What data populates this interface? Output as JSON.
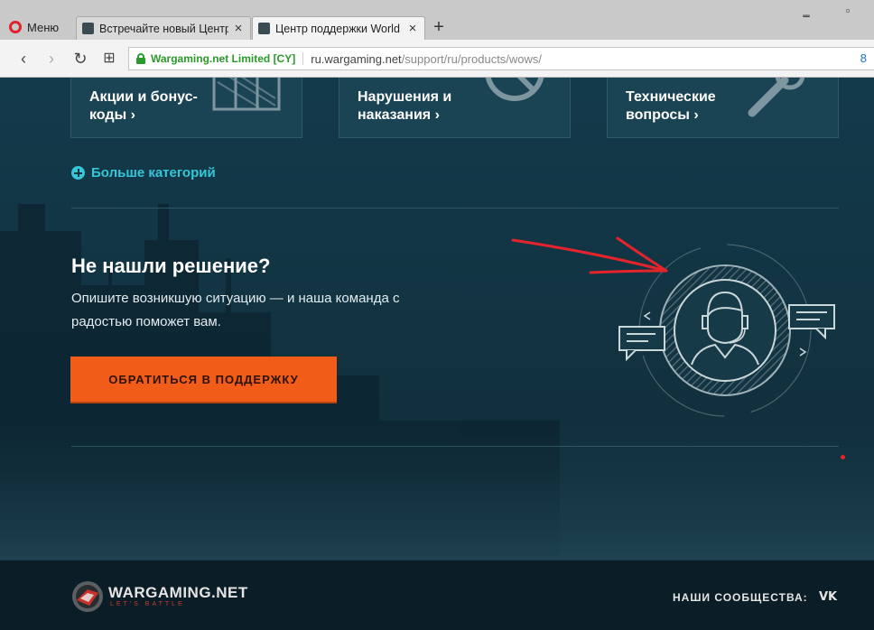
{
  "browser": {
    "menu_label": "Меню",
    "tabs": [
      {
        "title": "Встречайте новый Центр"
      },
      {
        "title": "Центр поддержки World"
      }
    ],
    "new_tab": "+",
    "window_controls": {
      "minimize": "‗",
      "restore": "▫"
    },
    "nav": {
      "back": "‹",
      "forward": "›",
      "reload": "↻",
      "grid": "⊞"
    },
    "address": {
      "certificate": "Wargaming.net Limited [CY]",
      "host": "ru.wargaming.net",
      "path": "/support/ru/products/wows/"
    },
    "extension_count": "8"
  },
  "categories": [
    {
      "label": "Акции и бонус-коды",
      "arrow": "›"
    },
    {
      "label": "Нарушения и наказания",
      "arrow": "›"
    },
    {
      "label": "Технические вопросы",
      "arrow": "›"
    }
  ],
  "more_categories": "Больше категорий",
  "not_found": {
    "title": "Не нашли решение?",
    "description": "Опишите возникшую ситуацию — и наша команда с радостью поможет вам.",
    "button": "ОБРАТИТЬСЯ В ПОДДЕРЖКУ"
  },
  "footer": {
    "brand": "WARGAMING.NET",
    "slogan": "LET'S BATTLE",
    "communities_label": "НАШИ СООБЩЕСТВА:",
    "vk_label": "VK"
  },
  "colors": {
    "accent_button": "#f25c19",
    "link_cyan": "#35c6d8",
    "page_bg": "#123443",
    "annotation_arrow": "#e5232b"
  }
}
